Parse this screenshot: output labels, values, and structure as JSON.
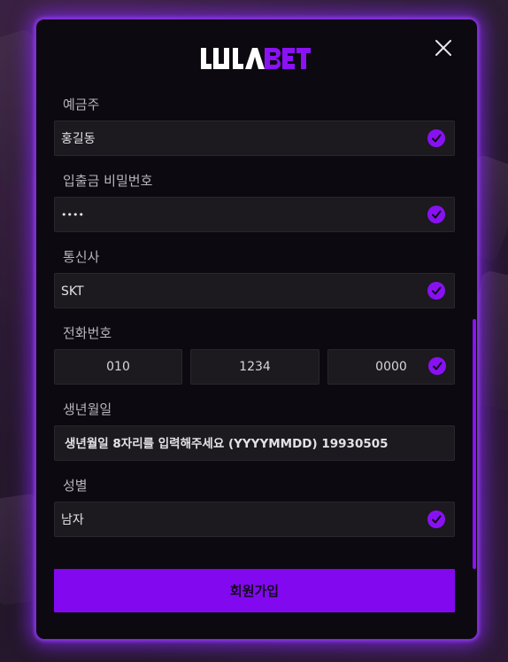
{
  "brand": {
    "logo_text": "LULABET",
    "accent": "#8208f0"
  },
  "icons": {
    "close": "close-icon",
    "check": "check-icon"
  },
  "form": {
    "account_holder": {
      "label": "예금주",
      "value": "홍길동"
    },
    "withdraw_password": {
      "label": "입출금 비밀번호",
      "value": "••••"
    },
    "carrier": {
      "label": "통신사",
      "value": "SKT"
    },
    "phone": {
      "label": "전화번호",
      "part1": "010",
      "part2": "1234",
      "part3": "0000"
    },
    "birthdate": {
      "label": "생년월일",
      "value": "생년월일 8자리를 입력해주세요 (YYYYMMDD) 19930505"
    },
    "gender": {
      "label": "성별",
      "value": "남자"
    }
  },
  "submit_label": "회원가입"
}
